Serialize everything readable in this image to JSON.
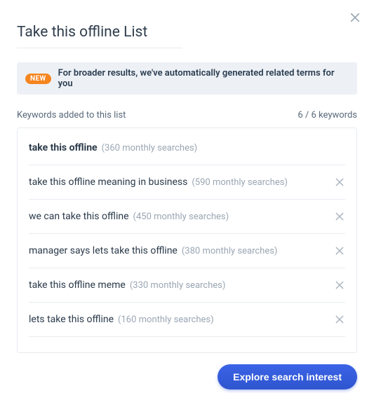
{
  "title": "Take this offline List",
  "banner": {
    "badge": "NEW",
    "text": "For broader results, we've automatically generated related terms for you"
  },
  "list_header": {
    "label": "Keywords added to this list",
    "count_text": "6 / 6 keywords"
  },
  "keywords": [
    {
      "term": "take this offline",
      "meta": "(360 monthly searches)",
      "primary": true,
      "removable": false
    },
    {
      "term": "take this offline meaning in business",
      "meta": "(590 monthly searches)",
      "primary": false,
      "removable": true
    },
    {
      "term": "we can take this offline",
      "meta": "(450 monthly searches)",
      "primary": false,
      "removable": true
    },
    {
      "term": "manager says lets take this offline",
      "meta": "(380 monthly searches)",
      "primary": false,
      "removable": true
    },
    {
      "term": "take this offline meme",
      "meta": "(330 monthly searches)",
      "primary": false,
      "removable": true
    },
    {
      "term": "lets take this offline",
      "meta": "(160 monthly searches)",
      "primary": false,
      "removable": true
    }
  ],
  "cta_label": "Explore search interest"
}
